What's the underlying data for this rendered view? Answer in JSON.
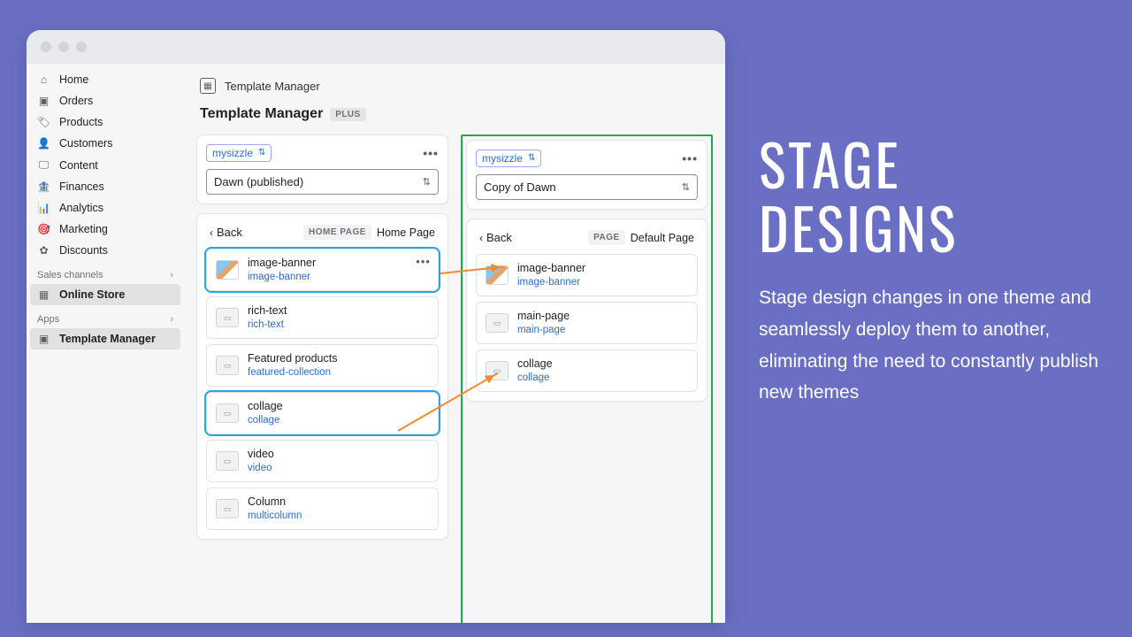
{
  "nav": {
    "main": [
      {
        "icon": "⌂",
        "label": "Home"
      },
      {
        "icon": "▣",
        "label": "Orders"
      },
      {
        "icon": "🏷",
        "label": "Products"
      },
      {
        "icon": "👤",
        "label": "Customers"
      },
      {
        "icon": "🖵",
        "label": "Content"
      },
      {
        "icon": "🏦",
        "label": "Finances"
      },
      {
        "icon": "📊",
        "label": "Analytics"
      },
      {
        "icon": "🎯",
        "label": "Marketing"
      },
      {
        "icon": "✿",
        "label": "Discounts"
      }
    ],
    "channels_label": "Sales channels",
    "channels": [
      {
        "icon": "▦",
        "label": "Online Store"
      }
    ],
    "apps_label": "Apps",
    "apps": [
      {
        "icon": "▣",
        "label": "Template Manager"
      }
    ]
  },
  "header": {
    "breadcrumb": "Template Manager",
    "title": "Template Manager",
    "badge": "PLUS"
  },
  "panel_left": {
    "store": "mysizzle",
    "theme": "Dawn (published)",
    "back": "Back",
    "type_badge": "HOME PAGE",
    "page_name": "Home Page",
    "sections": [
      {
        "name": "image-banner",
        "slug": "image-banner",
        "thumb": "img",
        "hl": true,
        "more": true
      },
      {
        "name": "rich-text",
        "slug": "rich-text"
      },
      {
        "name": "Featured products",
        "slug": "featured-collection"
      },
      {
        "name": "collage",
        "slug": "collage",
        "hl": true
      },
      {
        "name": "video",
        "slug": "video"
      },
      {
        "name": "Column",
        "slug": "multicolumn"
      }
    ]
  },
  "panel_right": {
    "store": "mysizzle",
    "theme": "Copy of Dawn",
    "back": "Back",
    "type_badge": "PAGE",
    "page_name": "Default Page",
    "sections": [
      {
        "name": "image-banner",
        "slug": "image-banner",
        "thumb": "img"
      },
      {
        "name": "main-page",
        "slug": "main-page"
      },
      {
        "name": "collage",
        "slug": "collage"
      }
    ]
  },
  "marketing": {
    "headline": "STAGE DESIGNS",
    "body": "Stage design changes in one theme and seamlessly deploy them to another, eliminating the need to constantly publish new themes"
  }
}
